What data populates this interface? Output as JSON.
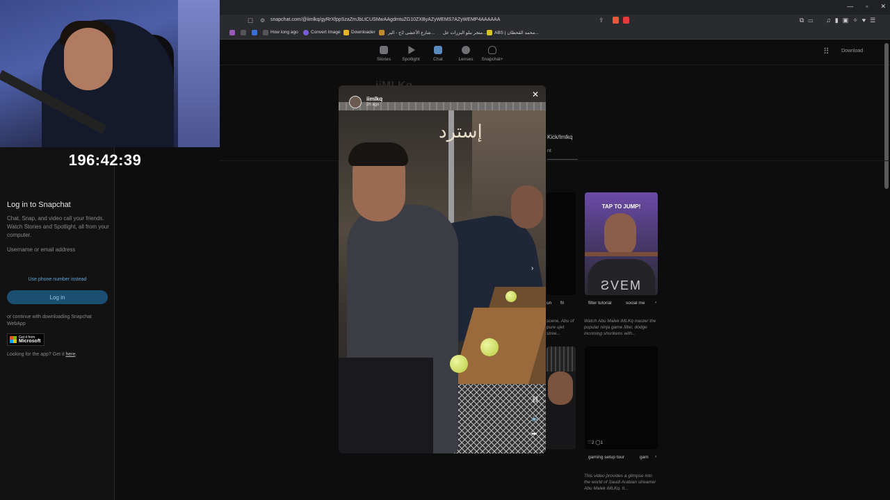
{
  "timer": "196:42:39",
  "browser": {
    "url": "snapchat.com/@iimlkq/gyRrXfppSzaZmJbLtCUSMwAAgdmtuZG10ZXByAZyWEMS7AZyWEMP4AAAAAA",
    "bookmarks": [
      "How long ago",
      "Convert Image",
      "Downloader",
      "شارع الأعشى 2ج - البر...",
      "متجر نبلو البزرات عل...",
      "ABS | محمد القحطان..."
    ],
    "window_controls": [
      "—",
      "▫",
      "✕"
    ]
  },
  "nav": {
    "items": [
      "Stories",
      "Spotlight",
      "Chat",
      "Lenses",
      "Snapchat+"
    ],
    "download": "Download"
  },
  "login": {
    "title": "Log in to Snapchat",
    "description": "Chat, Snap, and video call your friends. Watch Stories and Spotlight, all from your computer.",
    "username_label": "Username or email address",
    "phone_link": "Use phone number instead",
    "login_button": "Log in",
    "download_text": "or continue with downloading Snapchat WebApp",
    "ms_badge_top": "Get it from",
    "ms_badge_bottom": "Microsoft",
    "app_help_prefix": "Looking for the app? Get it ",
    "app_help_link": "here"
  },
  "profile": {
    "name": "iiMLKq",
    "kick_link": "Kick/Imlkq",
    "tab": "nt"
  },
  "cards": {
    "tap_title": "TAP TO JUMP!",
    "tap_overlay": "ƧVEM",
    "tags1": [
      "un",
      "fri",
      "filter tutorial",
      "social me"
    ],
    "desc1a": "scene, Abu of pure ujet stree...",
    "desc1b": "Watch Abu Malek iMLKq master the popular ninja game filter, dodge incoming shurikens with...",
    "stats": "♡2  ◯1",
    "tags2": [
      "gaming setup tour",
      "gam"
    ],
    "desc2": "This video provides a glimpse into the world of Saudi Arabian streamer Abu Malek iMLKq. It..."
  },
  "modal": {
    "username": "iimlkq",
    "time": "2h ago",
    "sign_text": "إسترد"
  }
}
